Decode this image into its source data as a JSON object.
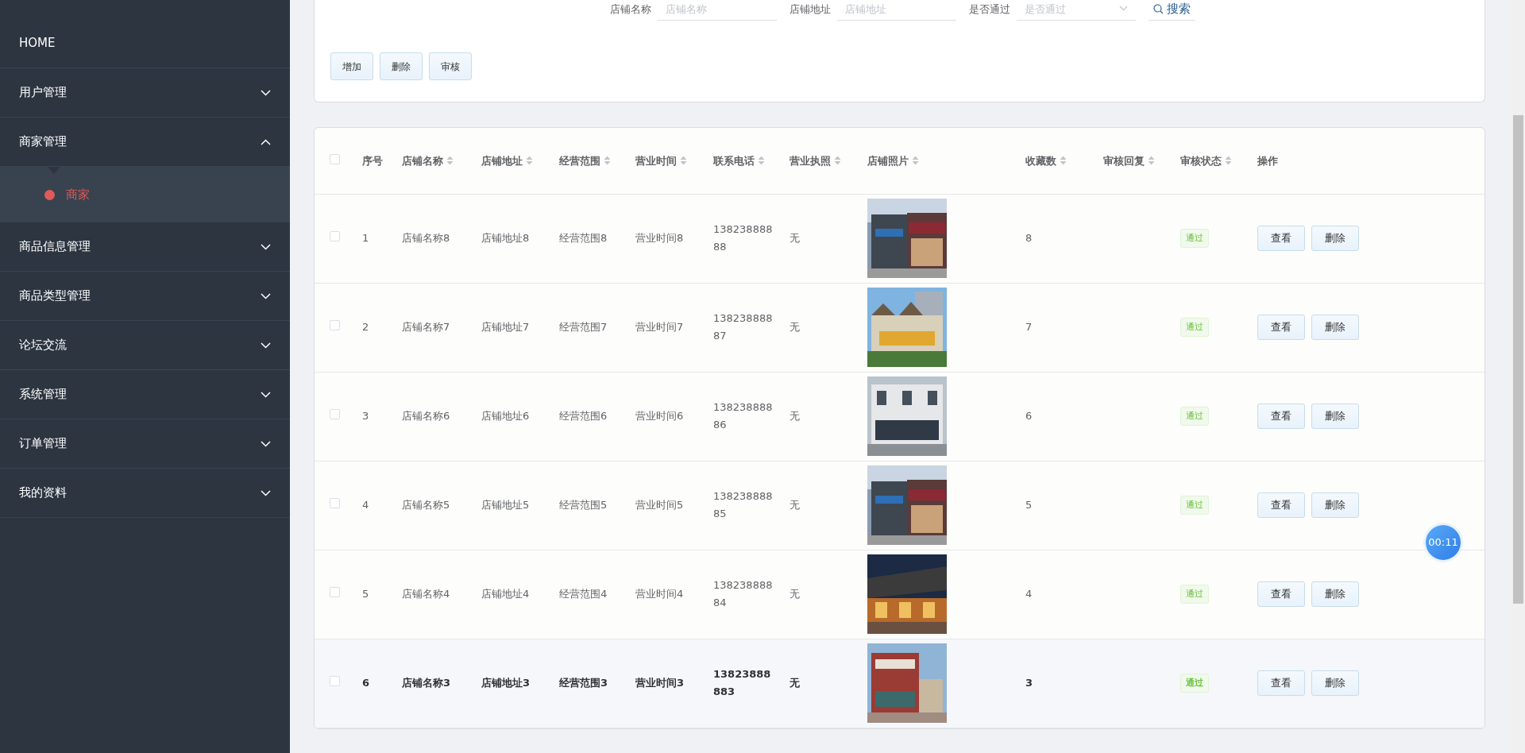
{
  "sidebar": {
    "items": [
      {
        "label": "HOME",
        "kind": "link"
      },
      {
        "label": "用户管理",
        "kind": "menu",
        "expanded": false
      },
      {
        "label": "商家管理",
        "kind": "menu",
        "expanded": true,
        "children": [
          {
            "label": "商家",
            "selected": true
          }
        ]
      },
      {
        "label": "商品信息管理",
        "kind": "menu",
        "expanded": false
      },
      {
        "label": "商品类型管理",
        "kind": "menu",
        "expanded": false
      },
      {
        "label": "论坛交流",
        "kind": "menu",
        "expanded": false
      },
      {
        "label": "系统管理",
        "kind": "menu",
        "expanded": false
      },
      {
        "label": "订单管理",
        "kind": "menu",
        "expanded": false
      },
      {
        "label": "我的资料",
        "kind": "menu",
        "expanded": false
      }
    ]
  },
  "search": {
    "fields": [
      {
        "label": "店铺名称",
        "placeholder": "店铺名称",
        "kind": "input"
      },
      {
        "label": "店铺地址",
        "placeholder": "店铺地址",
        "kind": "input"
      },
      {
        "label": "是否通过",
        "placeholder": "是否通过",
        "kind": "select"
      }
    ],
    "button": "搜索"
  },
  "actions": [
    "增加",
    "删除",
    "审核"
  ],
  "table": {
    "select_all": {
      "checked": false
    },
    "columns": [
      {
        "label": "序号",
        "sortable": false
      },
      {
        "label": "店铺名称",
        "sortable": true
      },
      {
        "label": "店铺地址",
        "sortable": true
      },
      {
        "label": "经营范围",
        "sortable": true
      },
      {
        "label": "营业时间",
        "sortable": true
      },
      {
        "label": "联系电话",
        "sortable": true
      },
      {
        "label": "营业执照",
        "sortable": true
      },
      {
        "label": "店铺照片",
        "sortable": true
      },
      {
        "label": "收藏数",
        "sortable": true
      },
      {
        "label": "审核回复",
        "sortable": true
      },
      {
        "label": "审核状态",
        "sortable": true
      },
      {
        "label": "操作",
        "sortable": false
      }
    ],
    "rows": [
      {
        "checked": false,
        "highlighted": false,
        "index": "1",
        "name": "店铺名称8",
        "address": "店铺地址8",
        "scope": "经营范围8",
        "hours": "营业时间8",
        "phone": "13823888888",
        "license": "无",
        "photo": {
          "kind": "picture"
        },
        "favorites": "8",
        "status": "通过",
        "buttons": [
          "查看",
          "删除"
        ]
      },
      {
        "checked": false,
        "highlighted": false,
        "index": "2",
        "name": "店铺名称7",
        "address": "店铺地址7",
        "scope": "经营范围7",
        "hours": "营业时间7",
        "phone": "13823888887",
        "license": "无",
        "photo": {
          "kind": "picture"
        },
        "favorites": "7",
        "status": "通过",
        "buttons": [
          "查看",
          "删除"
        ]
      },
      {
        "checked": false,
        "highlighted": false,
        "index": "3",
        "name": "店铺名称6",
        "address": "店铺地址6",
        "scope": "经营范围6",
        "hours": "营业时间6",
        "phone": "13823888886",
        "license": "无",
        "photo": {
          "kind": "picture"
        },
        "favorites": "6",
        "status": "通过",
        "buttons": [
          "查看",
          "删除"
        ]
      },
      {
        "checked": false,
        "highlighted": false,
        "index": "4",
        "name": "店铺名称5",
        "address": "店铺地址5",
        "scope": "经营范围5",
        "hours": "营业时间5",
        "phone": "13823888885",
        "license": "无",
        "photo": {
          "kind": "picture"
        },
        "favorites": "5",
        "status": "通过",
        "buttons": [
          "查看",
          "删除"
        ]
      },
      {
        "checked": false,
        "highlighted": false,
        "index": "5",
        "name": "店铺名称4",
        "address": "店铺地址4",
        "scope": "经营范围4",
        "hours": "营业时间4",
        "phone": "13823888884",
        "license": "无",
        "photo": {
          "kind": "picture"
        },
        "favorites": "4",
        "status": "通过",
        "buttons": [
          "查看",
          "删除"
        ]
      },
      {
        "checked": false,
        "highlighted": true,
        "index": "6",
        "name": "店铺名称3",
        "address": "店铺地址3",
        "scope": "经营范围3",
        "hours": "营业时间3",
        "phone": "13823888883",
        "license": "无",
        "photo": {
          "kind": "picture"
        },
        "favorites": "3",
        "status": "通过",
        "buttons": [
          "查看",
          "删除"
        ]
      }
    ]
  },
  "timer": "00:11"
}
